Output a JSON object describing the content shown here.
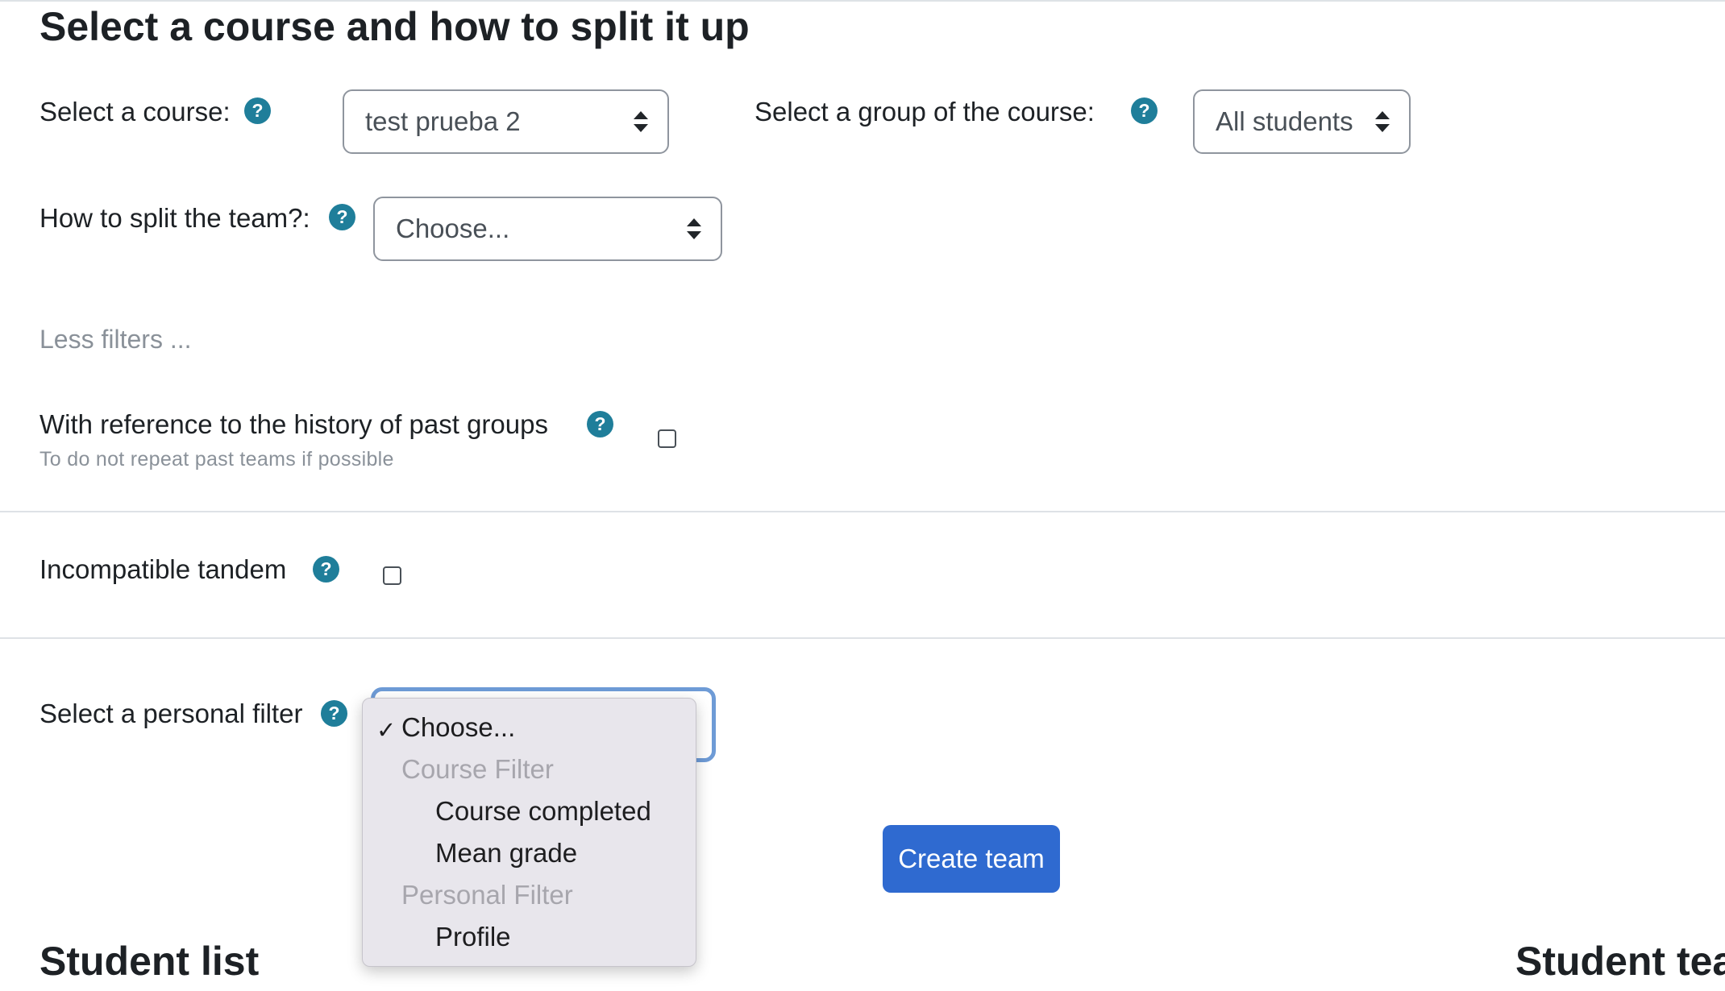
{
  "heading": "Select a course and how to split it up",
  "course": {
    "label": "Select a course:",
    "value": "test prueba 2"
  },
  "group": {
    "label": "Select a group of the course:",
    "value": "All students"
  },
  "split": {
    "label": "How to split the team?:",
    "value": "Choose..."
  },
  "help_glyph": "?",
  "less_filters": "Less filters ...",
  "history": {
    "label": "With reference to the history of past groups",
    "subtext": "To do not repeat past teams if possible",
    "checked": false
  },
  "tandem": {
    "label": "Incompatible tandem",
    "checked": false
  },
  "personal_filter": {
    "label": "Select a personal filter",
    "selected": "Choose...",
    "check_glyph": "✓",
    "options": [
      {
        "label": "Choose...",
        "kind": "option",
        "selected": true
      },
      {
        "label": "Course Filter",
        "kind": "group"
      },
      {
        "label": "Course completed",
        "kind": "option"
      },
      {
        "label": "Mean grade",
        "kind": "option"
      },
      {
        "label": "Personal Filter",
        "kind": "group"
      },
      {
        "label": "Profile",
        "kind": "option"
      }
    ]
  },
  "create_team_button": "Create team",
  "student_list_heading": "Student list",
  "student_teams_heading": "Student tea",
  "colors": {
    "help": "#1f7e9a",
    "primary": "#2f6ad0",
    "focus": "#6e9bd6"
  },
  "icons": {
    "help": "question-circle-icon",
    "select_arrows": "sort-arrows-icon",
    "check": "checkmark-icon"
  }
}
